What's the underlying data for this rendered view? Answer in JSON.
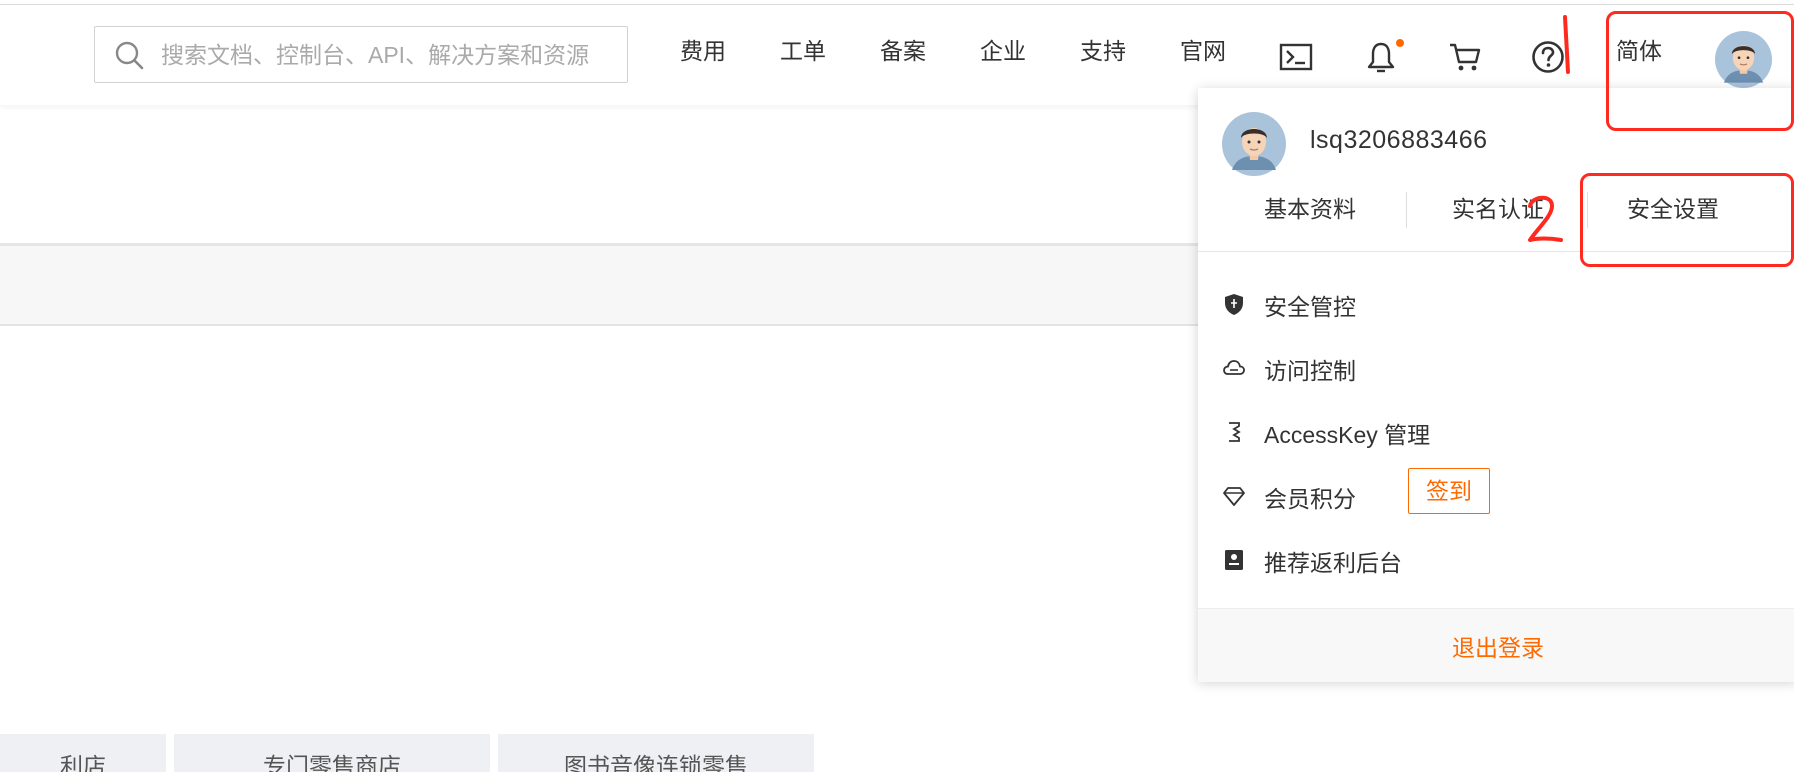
{
  "search": {
    "placeholder": "搜索文档、控制台、API、解决方案和资源"
  },
  "nav": {
    "links": [
      "费用",
      "工单",
      "备案",
      "企业",
      "支持",
      "官网"
    ],
    "language": "简体",
    "icons": [
      "terminal-icon",
      "bell-icon",
      "cart-icon",
      "help-icon"
    ],
    "notification_dot_color": "#ff6a00"
  },
  "dropdown": {
    "username": "lsq3206883466",
    "links": [
      "基本资料",
      "实名认证",
      "安全设置"
    ],
    "menu": [
      {
        "label": "安全管控",
        "icon": "shield-icon"
      },
      {
        "label": "访问控制",
        "icon": "cloud-icon"
      },
      {
        "label": "AccessKey 管理",
        "icon": "key-icon"
      },
      {
        "label": "会员积分",
        "icon": "diamond-icon"
      },
      {
        "label": "推荐返利后台",
        "icon": "document-icon"
      }
    ],
    "checkin_label": "签到",
    "logout_label": "退出登录"
  },
  "background_cards": [
    "利店",
    "专门零售商店",
    "图书音像连锁零售"
  ],
  "accent_color": "#ff6a00",
  "annotation_color": "#ff2a1f"
}
